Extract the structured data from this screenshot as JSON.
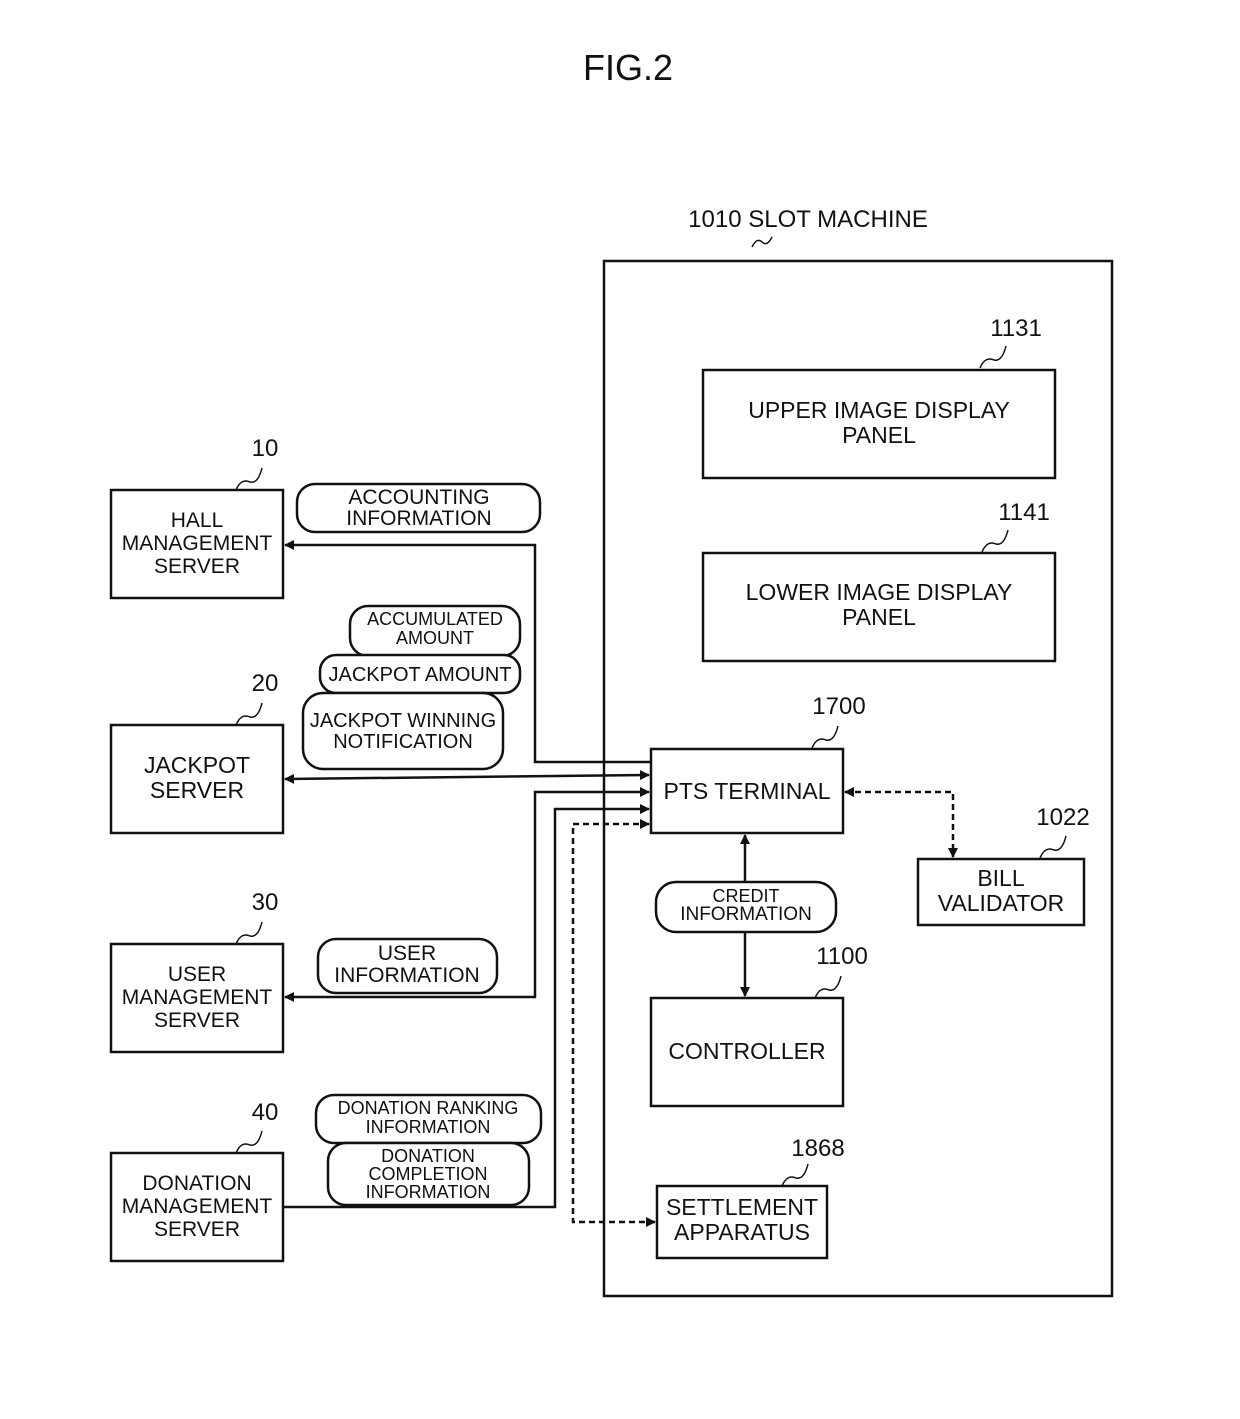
{
  "figure_title": "FIG.2",
  "slot_machine": {
    "ref": "1010",
    "label": "1010 SLOT MACHINE"
  },
  "servers": [
    {
      "ref": "10",
      "lines": [
        "HALL",
        "MANAGEMENT",
        "SERVER"
      ]
    },
    {
      "ref": "20",
      "lines": [
        "JACKPOT",
        "SERVER"
      ]
    },
    {
      "ref": "30",
      "lines": [
        "USER",
        "MANAGEMENT",
        "SERVER"
      ]
    },
    {
      "ref": "40",
      "lines": [
        "DONATION",
        "MANAGEMENT",
        "SERVER"
      ]
    }
  ],
  "components": {
    "upper_panel": {
      "ref": "1131",
      "lines": [
        "UPPER IMAGE DISPLAY",
        "PANEL"
      ]
    },
    "lower_panel": {
      "ref": "1141",
      "lines": [
        "LOWER IMAGE DISPLAY",
        "PANEL"
      ]
    },
    "pts_terminal": {
      "ref": "1700",
      "lines": [
        "PTS TERMINAL"
      ]
    },
    "bill_validator": {
      "ref": "1022",
      "lines": [
        "BILL",
        "VALIDATOR"
      ]
    },
    "controller": {
      "ref": "1100",
      "lines": [
        "CONTROLLER"
      ]
    },
    "settlement": {
      "ref": "1868",
      "lines": [
        "SETTLEMENT",
        "APPARATUS"
      ]
    }
  },
  "info_labels": {
    "accounting": [
      "ACCOUNTING",
      "INFORMATION"
    ],
    "accumulated": [
      "ACCUMULATED",
      "AMOUNT"
    ],
    "jackpot_amount": [
      "JACKPOT AMOUNT"
    ],
    "jackpot_winning": [
      "JACKPOT WINNING",
      "NOTIFICATION"
    ],
    "user_info": [
      "USER",
      "INFORMATION"
    ],
    "donation_ranking": [
      "DONATION RANKING",
      "INFORMATION"
    ],
    "donation_completion": [
      "DONATION",
      "COMPLETION",
      "INFORMATION"
    ],
    "credit": [
      "CREDIT",
      "INFORMATION"
    ]
  }
}
